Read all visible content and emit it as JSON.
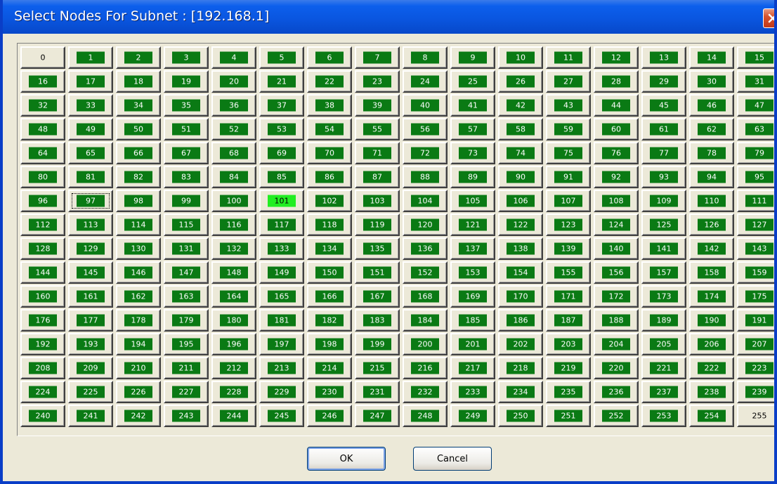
{
  "window": {
    "title": "Select Nodes For Subnet : [192.168.1]"
  },
  "grid": {
    "nodes": [
      "0",
      "1",
      "2",
      "3",
      "4",
      "5",
      "6",
      "7",
      "8",
      "9",
      "10",
      "11",
      "12",
      "13",
      "14",
      "15",
      "16",
      "17",
      "18",
      "19",
      "20",
      "21",
      "22",
      "23",
      "24",
      "25",
      "26",
      "27",
      "28",
      "29",
      "30",
      "31",
      "32",
      "33",
      "34",
      "35",
      "36",
      "37",
      "38",
      "39",
      "40",
      "41",
      "42",
      "43",
      "44",
      "45",
      "46",
      "47",
      "48",
      "49",
      "50",
      "51",
      "52",
      "53",
      "54",
      "55",
      "56",
      "57",
      "58",
      "59",
      "60",
      "61",
      "62",
      "63",
      "64",
      "65",
      "66",
      "67",
      "68",
      "69",
      "70",
      "71",
      "72",
      "73",
      "74",
      "75",
      "76",
      "77",
      "78",
      "79",
      "80",
      "81",
      "82",
      "83",
      "84",
      "85",
      "86",
      "87",
      "88",
      "89",
      "90",
      "91",
      "92",
      "93",
      "94",
      "95",
      "96",
      "97",
      "98",
      "99",
      "100",
      "101",
      "102",
      "103",
      "104",
      "105",
      "106",
      "107",
      "108",
      "109",
      "110",
      "111",
      "112",
      "113",
      "114",
      "115",
      "116",
      "117",
      "118",
      "119",
      "120",
      "121",
      "122",
      "123",
      "124",
      "125",
      "126",
      "127",
      "128",
      "129",
      "130",
      "131",
      "132",
      "133",
      "134",
      "135",
      "136",
      "137",
      "138",
      "139",
      "140",
      "141",
      "142",
      "143",
      "144",
      "145",
      "146",
      "147",
      "148",
      "149",
      "150",
      "151",
      "152",
      "153",
      "154",
      "155",
      "156",
      "157",
      "158",
      "159",
      "160",
      "161",
      "162",
      "163",
      "164",
      "165",
      "166",
      "167",
      "168",
      "169",
      "170",
      "171",
      "172",
      "173",
      "174",
      "175",
      "176",
      "177",
      "178",
      "179",
      "180",
      "181",
      "182",
      "183",
      "184",
      "185",
      "186",
      "187",
      "188",
      "189",
      "190",
      "191",
      "192",
      "193",
      "194",
      "195",
      "196",
      "197",
      "198",
      "199",
      "200",
      "201",
      "202",
      "203",
      "204",
      "205",
      "206",
      "207",
      "208",
      "209",
      "210",
      "211",
      "212",
      "213",
      "214",
      "215",
      "216",
      "217",
      "218",
      "219",
      "220",
      "221",
      "222",
      "223",
      "224",
      "225",
      "226",
      "227",
      "228",
      "229",
      "230",
      "231",
      "232",
      "233",
      "234",
      "235",
      "236",
      "237",
      "238",
      "239",
      "240",
      "241",
      "242",
      "243",
      "244",
      "245",
      "246",
      "247",
      "248",
      "249",
      "250",
      "251",
      "252",
      "253",
      "254",
      "255"
    ],
    "unselected": [
      0,
      255
    ],
    "active": [
      101
    ],
    "focused": 97,
    "colors": {
      "selected": "#0a7a14",
      "active": "#22ee22",
      "button_face": "#ece9d8"
    }
  },
  "buttons": {
    "ok": "OK",
    "cancel": "Cancel"
  }
}
